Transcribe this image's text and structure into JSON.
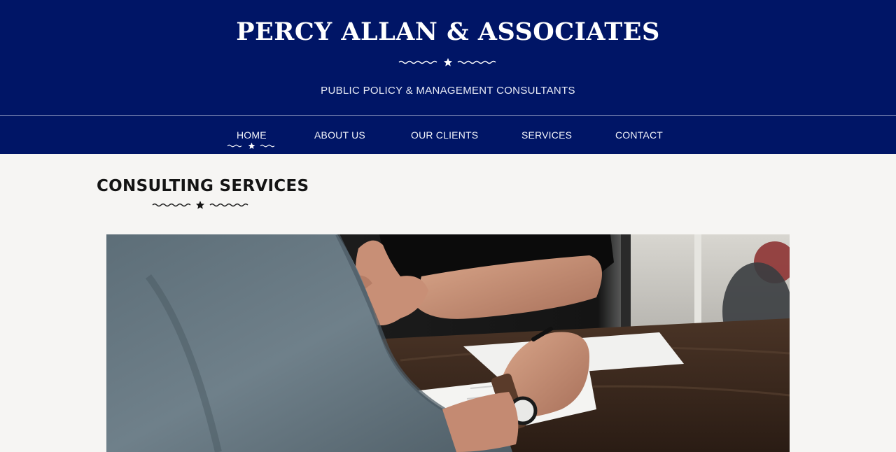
{
  "header": {
    "title": "PERCY ALLAN & ASSOCIATES",
    "tagline": "PUBLIC POLICY & MANAGEMENT CONSULTANTS"
  },
  "nav": {
    "items": [
      {
        "label": "HOME",
        "active": true
      },
      {
        "label": "ABOUT US",
        "active": false
      },
      {
        "label": "OUR CLIENTS",
        "active": false
      },
      {
        "label": "SERVICES",
        "active": false
      },
      {
        "label": "CONTACT",
        "active": false
      }
    ]
  },
  "main": {
    "heading": "CONSULTING SERVICES",
    "hero_image": "consulting-meeting-photo"
  },
  "colors": {
    "brand_navy": "#001566",
    "page_background": "#f6f5f3",
    "heading_text": "#141414"
  }
}
